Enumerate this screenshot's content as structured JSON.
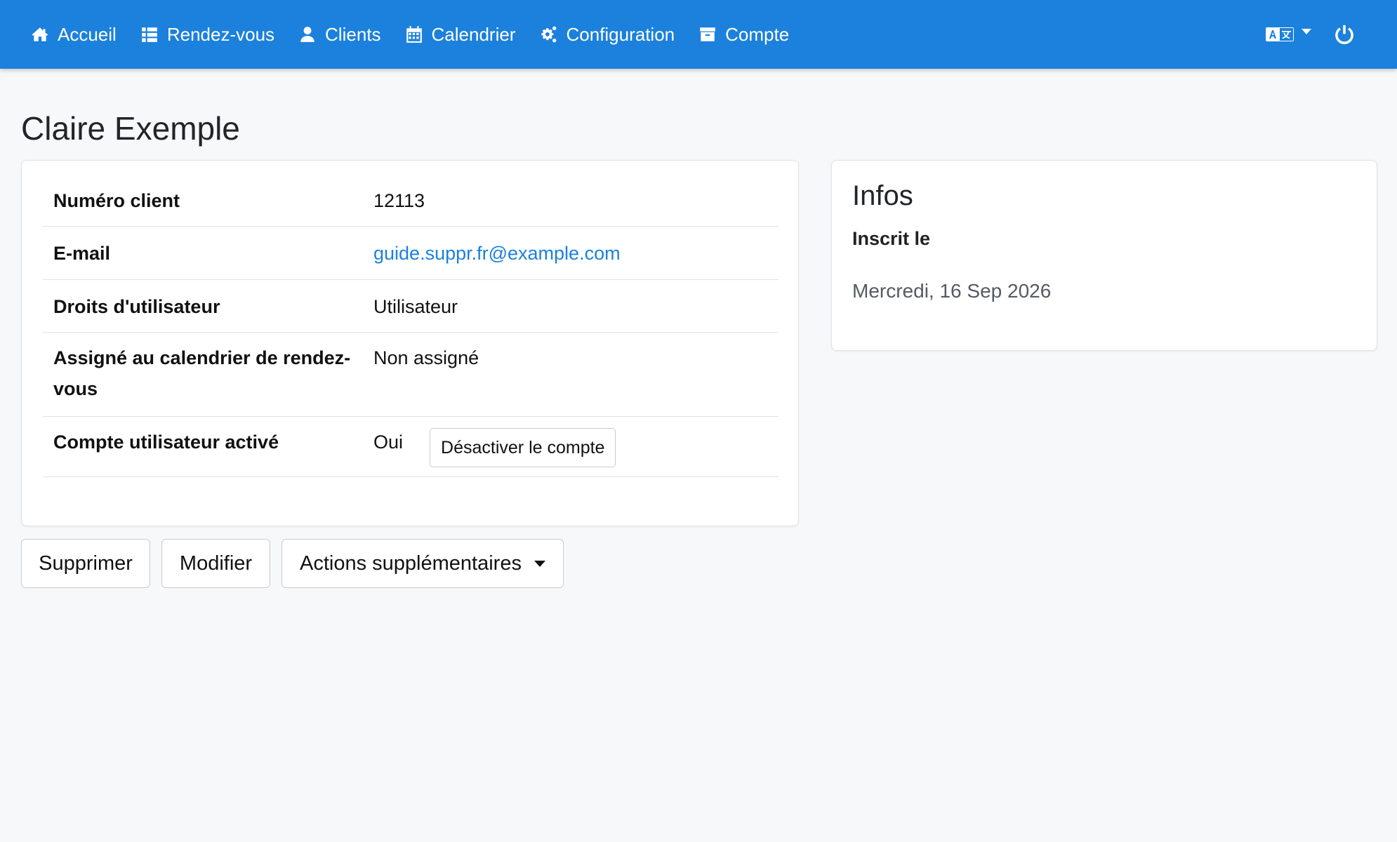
{
  "nav": {
    "items": [
      {
        "label": "Accueil",
        "icon": "home-icon"
      },
      {
        "label": "Rendez-vous",
        "icon": "list-icon"
      },
      {
        "label": "Clients",
        "icon": "user-icon"
      },
      {
        "label": "Calendrier",
        "icon": "calendar-icon"
      },
      {
        "label": "Configuration",
        "icon": "cogs-icon"
      },
      {
        "label": "Compte",
        "icon": "archive-icon"
      }
    ],
    "language_icon": "language-icon",
    "logout_icon": "power-icon"
  },
  "page": {
    "title": "Claire Exemple"
  },
  "details": {
    "client_number_label": "Numéro client",
    "client_number_value": "12113",
    "email_label": "E-mail",
    "email_value": "guide.suppr.fr@example.com",
    "rights_label": "Droits d'utilisateur",
    "rights_value": "Utilisateur",
    "assigned_label": "Assigné au calendrier de rendez-vous",
    "assigned_value": "Non assigné",
    "active_label": "Compte utilisateur activé",
    "active_value": "Oui",
    "deactivate_button": "Désactiver le compte"
  },
  "info": {
    "title": "Infos",
    "registered_label": "Inscrit le",
    "registered_value": "Mercredi, 16 Sep 2026"
  },
  "actions": {
    "delete": "Supprimer",
    "edit": "Modifier",
    "more": "Actions supplémentaires"
  },
  "colors": {
    "navbar": "#1b81dc",
    "link": "#1b81dc",
    "background": "#f7f8fa"
  }
}
